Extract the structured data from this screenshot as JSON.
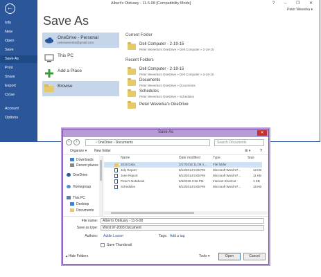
{
  "app": {
    "title": "Albert's Obituary - 11-5-08 [Compatibility Mode]",
    "window_controls": "? – ❐ ✕",
    "user": "Peter Weverka ▾"
  },
  "sidebar": {
    "items": [
      {
        "label": "Info"
      },
      {
        "label": "New"
      },
      {
        "label": "Open"
      },
      {
        "label": "Save"
      },
      {
        "label": "Save As"
      },
      {
        "label": "Print"
      },
      {
        "label": "Share"
      },
      {
        "label": "Export"
      },
      {
        "label": "Close"
      },
      {
        "label": "Account"
      },
      {
        "label": "Options"
      }
    ],
    "active_index": 4
  },
  "page_title": "Save As",
  "locations": [
    {
      "label": "OneDrive - Personal",
      "sub": "peterweverka@gmail.com",
      "icon": "cloud-icon"
    },
    {
      "label": "This PC",
      "sub": "",
      "icon": "computer-icon"
    },
    {
      "label": "Add a Place",
      "sub": "",
      "icon": "plus-icon"
    },
    {
      "label": "Browse",
      "sub": "",
      "icon": "folder-icon"
    }
  ],
  "current_folder": {
    "heading": "Current Folder",
    "name": "Dell Computer - 2-19-15",
    "path": "Peter Weverka's OneDrive » Dell Computer » 2-19-15"
  },
  "recent_folders": {
    "heading": "Recent Folders",
    "items": [
      {
        "name": "Dell Computer - 2-19-15",
        "path": "Peter Weverka's OneDrive » Dell Computer » 2-19-15"
      },
      {
        "name": "Documents",
        "path": "Peter Weverka's OneDrive » Documents"
      },
      {
        "name": "Schedules",
        "path": "Peter Weverka's OneDrive » Schedules"
      },
      {
        "name": "Peter Weverka's OneDrive",
        "path": ""
      }
    ]
  },
  "dialog": {
    "title": "Save As",
    "close": "✕",
    "address": "‹ OneDrive › Documents",
    "search_placeholder": "Search Documents",
    "organize": "Organize ▾",
    "new_folder": "New folder",
    "nav_pane": [
      "Downloads",
      "Recent places",
      "OneDrive",
      "Homegroup",
      "This PC",
      "Desktop",
      "Documents"
    ],
    "columns": {
      "name": "Name",
      "date": "Date modified",
      "type": "Type",
      "size": "Size"
    },
    "files": [
      {
        "name": "2015 Data",
        "date": "2/17/2015 11:08 A...",
        "type": "File folder",
        "size": "",
        "kind": "folder"
      },
      {
        "name": "July Report",
        "date": "8/12/2014 5:06 PM",
        "type": "Microsoft Word 97...",
        "size": "12 KB",
        "kind": "doc"
      },
      {
        "name": "June Report",
        "date": "8/12/2014 5:06 PM",
        "type": "Microsoft Word 97...",
        "size": "11 KB",
        "kind": "doc"
      },
      {
        "name": "Peter's Notebook",
        "date": "5/5/2015 2:55 PM",
        "type": "Internet Shortcut",
        "size": "1 KB",
        "kind": "doc"
      },
      {
        "name": "Schedules",
        "date": "8/12/2014 5:06 PM",
        "type": "Microsoft Word 97...",
        "size": "15 KB",
        "kind": "doc"
      }
    ],
    "file_name_label": "File name:",
    "file_name_value": "Albert's Obituary - 11-5-08",
    "save_type_label": "Save as type:",
    "save_type_value": "Word 97-2003 Document",
    "authors_label": "Authors:",
    "authors_value": "Addie Lasser",
    "tags_label": "Tags:",
    "tags_value": "Add a tag",
    "thumbnail_label": "Save Thumbnail",
    "hide_folders": "Hide Folders",
    "tools": "Tools ▾",
    "open_btn": "Open",
    "cancel_btn": "Cancel"
  }
}
